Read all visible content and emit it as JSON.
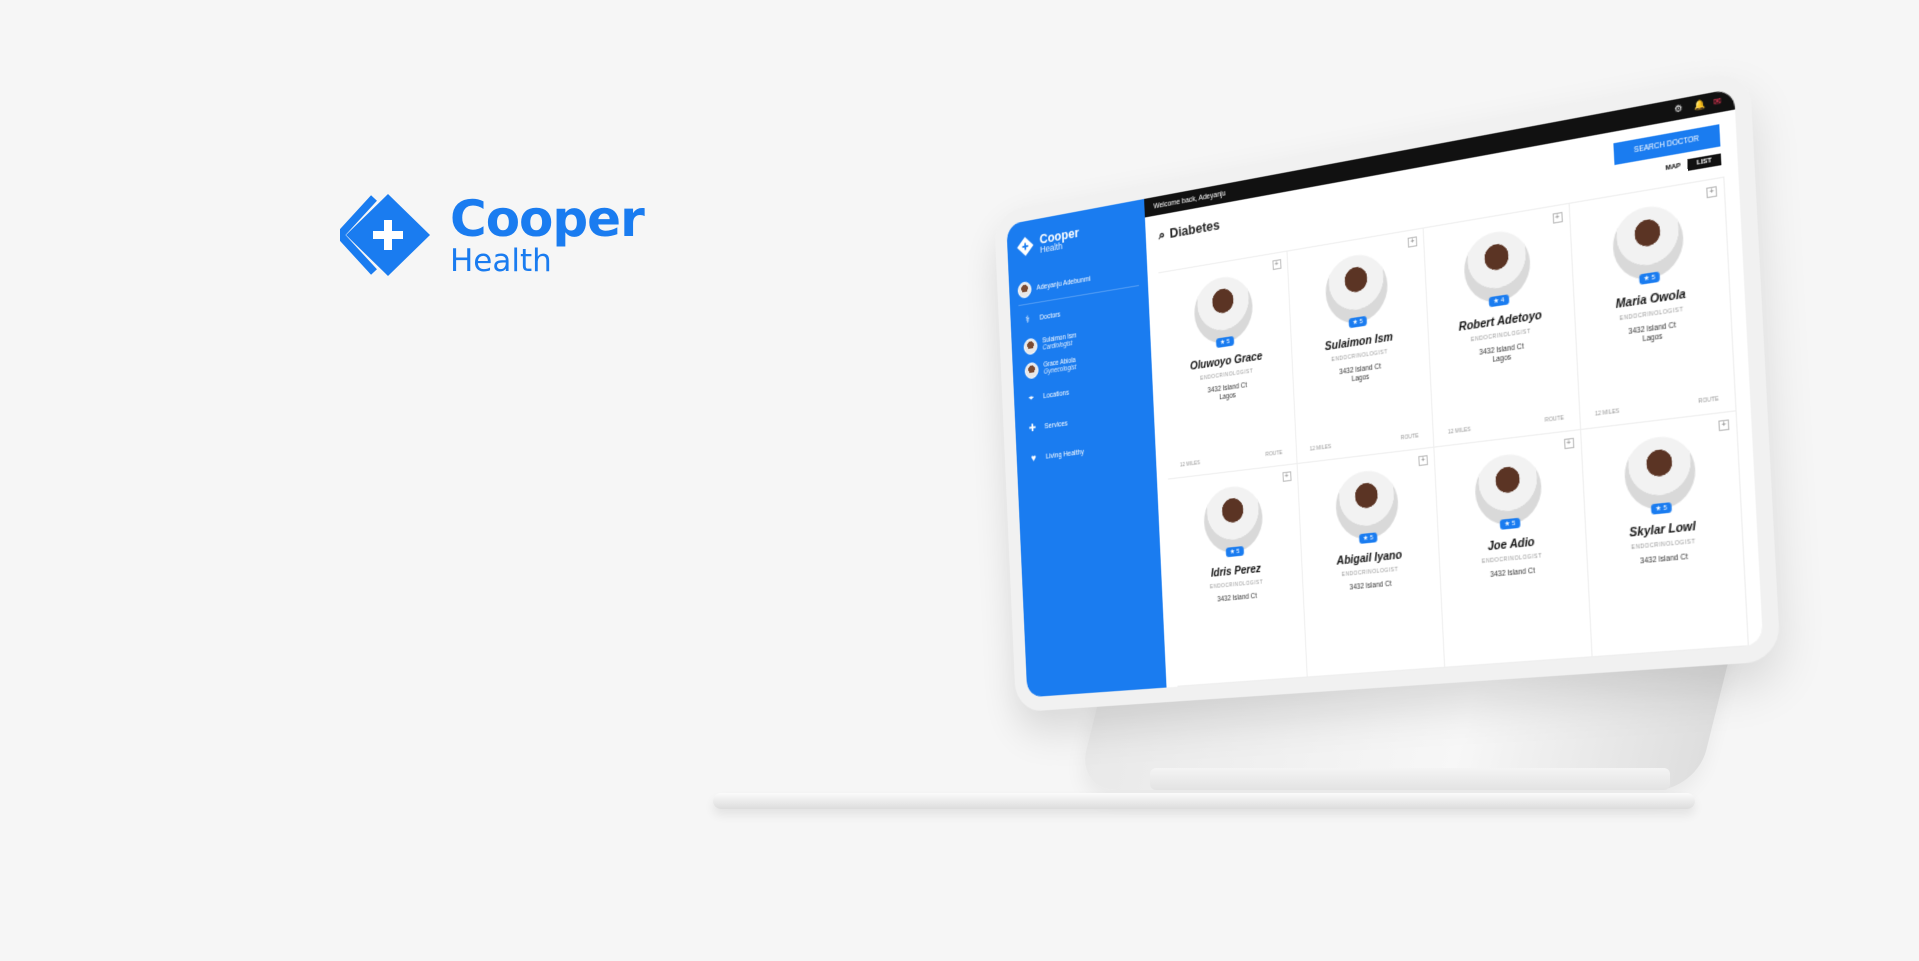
{
  "brand": {
    "name": "Cooper",
    "sub": "Health",
    "color": "#1a7cf0"
  },
  "app": {
    "sidebar": {
      "logo_name": "Cooper",
      "logo_sub": "Health",
      "user": "Adeyanju Adebunmi",
      "items": [
        {
          "label": "Doctors",
          "icon": "stethoscope-icon"
        },
        {
          "label": "Locations",
          "icon": "location-pin-icon"
        },
        {
          "label": "Services",
          "icon": "plus-icon"
        },
        {
          "label": "Living Healthy",
          "icon": "heart-icon"
        }
      ],
      "doctors": [
        {
          "name": "Sulaimon Ism",
          "role": "Cardiologist"
        },
        {
          "name": "Grace Abiola",
          "role": "Gynecologist"
        }
      ]
    },
    "topbar": {
      "welcome": "Welcome back, Adeyanju"
    },
    "search": {
      "query": "Diabetes",
      "button": "SEARCH DOCTOR"
    },
    "toggle": {
      "map": "MAP",
      "list": "LIST"
    },
    "doctors": [
      {
        "name": "Oluwoyo Grace",
        "specialty": "ENDOCRINOLOGIST",
        "addr1": "3432 Island Ct",
        "addr2": "Lagos",
        "rating": "5",
        "distance": "12 MILES",
        "route": "ROUTE"
      },
      {
        "name": "Sulaimon Ism",
        "specialty": "ENDOCRINOLOGIST",
        "addr1": "3432 Island Ct",
        "addr2": "Lagos",
        "rating": "5",
        "distance": "12 MILES",
        "route": "ROUTE"
      },
      {
        "name": "Robert Adetoyo",
        "specialty": "ENDOCRINOLOGIST",
        "addr1": "3432 Island Ct",
        "addr2": "Lagos",
        "rating": "4",
        "distance": "12 MILES",
        "route": "ROUTE"
      },
      {
        "name": "Maria Owola",
        "specialty": "ENDOCRINOLOGIST",
        "addr1": "3432 Island Ct",
        "addr2": "Lagos",
        "rating": "5",
        "distance": "12 MILES",
        "route": "ROUTE"
      },
      {
        "name": "Idris Perez",
        "specialty": "ENDOCRINOLOGIST",
        "addr1": "3432 Island Ct",
        "addr2": "",
        "rating": "5",
        "distance": "",
        "route": ""
      },
      {
        "name": "Abigail Iyano",
        "specialty": "ENDOCRINOLOGIST",
        "addr1": "3432 Island Ct",
        "addr2": "",
        "rating": "5",
        "distance": "",
        "route": ""
      },
      {
        "name": "Joe Adio",
        "specialty": "ENDOCRINOLOGIST",
        "addr1": "3432 Island Ct",
        "addr2": "",
        "rating": "5",
        "distance": "",
        "route": ""
      },
      {
        "name": "Skylar Lowl",
        "specialty": "ENDOCRINOLOGIST",
        "addr1": "3432 Island Ct",
        "addr2": "",
        "rating": "5",
        "distance": "",
        "route": ""
      }
    ]
  }
}
